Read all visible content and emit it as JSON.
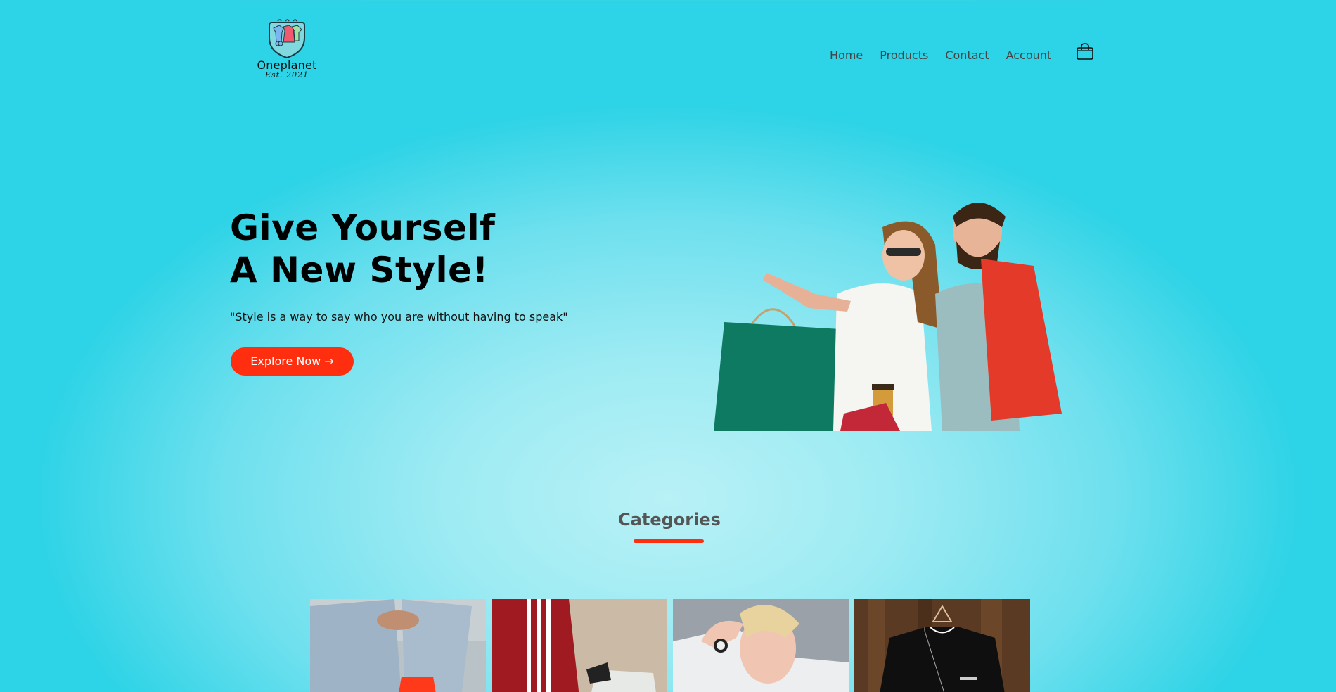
{
  "header": {
    "brand_name": "Oneplanet",
    "brand_est": "Est. 2021",
    "logo_icon": "clothes-hanger-shield-logo",
    "nav": [
      {
        "label": "Home"
      },
      {
        "label": "Products"
      },
      {
        "label": "Contact"
      },
      {
        "label": "Account"
      }
    ],
    "cart_icon": "shopping-bag-icon"
  },
  "hero": {
    "title_line1": "Give Yourself",
    "title_line2": "A New Style!",
    "quote": "\"Style is a way to say who you are without having to speak\"",
    "cta_label": "Explore Now →",
    "image": "couple-with-shopping-bags"
  },
  "categories": {
    "title": "Categories",
    "items": [
      {
        "image": "ripped-jeans-red-sneakers"
      },
      {
        "image": "striped-trackpants-sneakers"
      },
      {
        "image": "woman-white-hoodie-watch"
      },
      {
        "image": "black-sweatshirt-on-hanger"
      }
    ]
  },
  "colors": {
    "accent": "#ff2e0e",
    "background": "#5cdcec",
    "nav_text": "#444444",
    "heading": "#555555"
  }
}
